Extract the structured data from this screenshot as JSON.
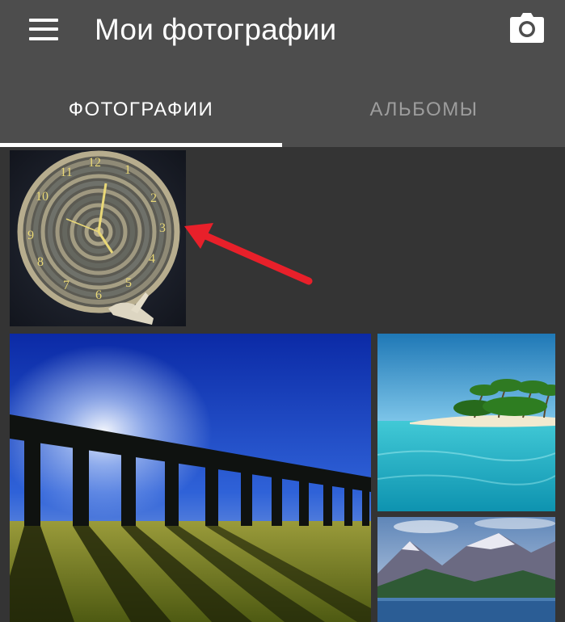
{
  "app_bar": {
    "title": "Мои фотографии",
    "menu_icon": "hamburger-menu-icon",
    "camera_icon": "camera-icon",
    "background": "#4d4d4d"
  },
  "tabs": [
    {
      "label": "ФОТОГРАФИИ",
      "selected": true
    },
    {
      "label": "АЛЬБОМЫ",
      "selected": false
    }
  ],
  "annotation": {
    "icon": "red-arrow-icon",
    "color": "#e8202a"
  },
  "photos": [
    {
      "subject": "rope clock"
    },
    {
      "subject": "aqueduct at sunrise"
    },
    {
      "subject": "tropical beach"
    },
    {
      "subject": "mountain lake"
    }
  ],
  "clock_numerals": [
    "12",
    "1",
    "2",
    "3",
    "4",
    "5",
    "6",
    "7",
    "8",
    "9",
    "10",
    "11"
  ]
}
